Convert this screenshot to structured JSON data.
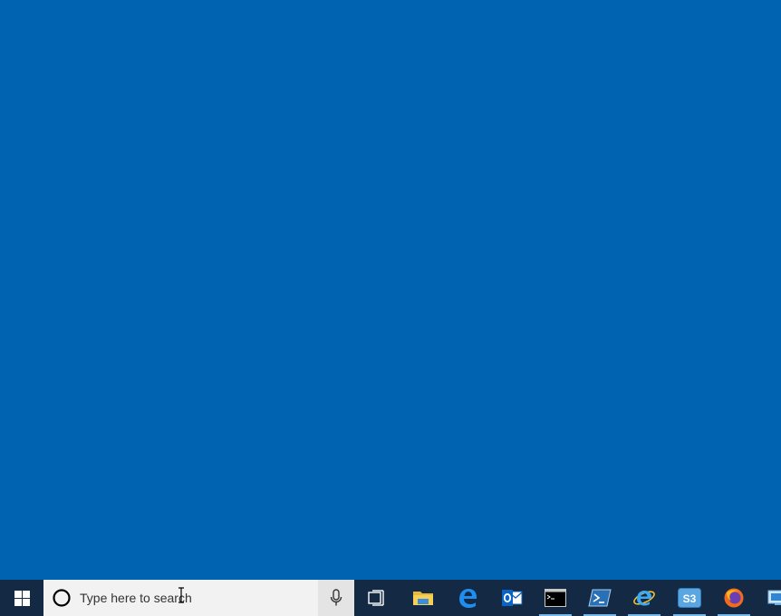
{
  "desktop": {
    "background": "#0063b1"
  },
  "taskbar": {
    "background": "#142a44",
    "start": {
      "icon": "windows-logo-icon"
    },
    "search": {
      "placeholder": "Type here to search",
      "left_icon": "cortana-circle-icon",
      "right_icon": "microphone-icon"
    },
    "task_view": {
      "icon": "task-view-icon"
    },
    "apps": [
      {
        "name": "file-explorer",
        "icon": "folder-icon",
        "running": false
      },
      {
        "name": "edge",
        "icon": "edge-e-icon",
        "running": false
      },
      {
        "name": "outlook",
        "icon": "outlook-icon",
        "running": false
      },
      {
        "name": "command-prompt",
        "icon": "cmd-icon",
        "running": true
      },
      {
        "name": "powershell",
        "icon": "powershell-icon",
        "running": true
      },
      {
        "name": "internet-explorer",
        "icon": "ie-icon",
        "running": true
      },
      {
        "name": "s3",
        "icon": "s3-icon",
        "label": "S3",
        "running": true
      },
      {
        "name": "firefox",
        "icon": "firefox-icon",
        "running": true
      },
      {
        "name": "remote-desktop",
        "icon": "remote-desktop-icon",
        "running": false
      }
    ]
  }
}
